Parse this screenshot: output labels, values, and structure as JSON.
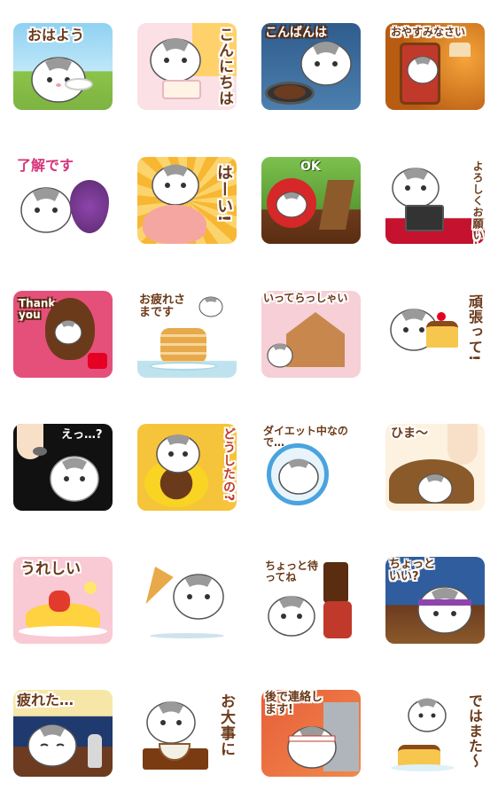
{
  "stickers": [
    {
      "caption": "おはよう"
    },
    {
      "caption": "こんにちは"
    },
    {
      "caption": "こんばんは"
    },
    {
      "caption": "おやすみなさい"
    },
    {
      "caption": "了解です"
    },
    {
      "caption": "はーい!"
    },
    {
      "caption": "OK"
    },
    {
      "caption": "よろしくお願いします"
    },
    {
      "caption": "Thank you"
    },
    {
      "caption": "お疲れさまです"
    },
    {
      "caption": "いってらっしゃい"
    },
    {
      "caption": "頑張って!"
    },
    {
      "caption": "えっ…?"
    },
    {
      "caption": "どうしたの?"
    },
    {
      "caption": "ダイエット中なので…"
    },
    {
      "caption": "ひま～"
    },
    {
      "caption": "うれしい"
    },
    {
      "caption": ""
    },
    {
      "caption": "ちょっと待ってね"
    },
    {
      "caption": "ちょっといい?"
    },
    {
      "caption": "疲れた…"
    },
    {
      "caption": "お大事に"
    },
    {
      "caption": "後で連絡します!"
    },
    {
      "caption": "ではまた～"
    }
  ],
  "colors": {
    "caption_brown": "#6b3a1a",
    "hamster_fur": "#ffffff",
    "hamster_stripe": "#9a9a9a"
  }
}
